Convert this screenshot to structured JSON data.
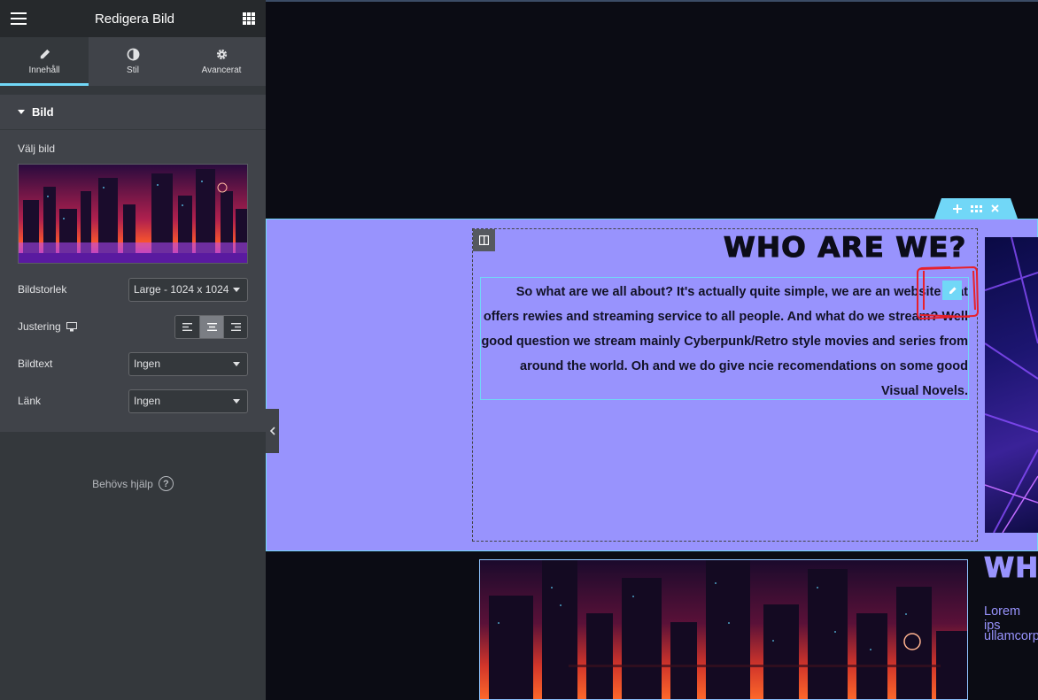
{
  "sidebar": {
    "title": "Redigera Bild",
    "tabs": [
      {
        "label": "Innehåll",
        "icon": "pencil-icon"
      },
      {
        "label": "Stil",
        "icon": "half-circle-icon"
      },
      {
        "label": "Avancerat",
        "icon": "gear-icon"
      }
    ],
    "section_title": "Bild",
    "choose_image_label": "Välj bild",
    "image_size": {
      "label": "Bildstorlek",
      "value": "Large - 1024 x 1024"
    },
    "alignment": {
      "label": "Justering",
      "selected": "center"
    },
    "caption": {
      "label": "Bildtext",
      "value": "Ingen"
    },
    "link": {
      "label": "Länk",
      "value": "Ingen"
    },
    "help_label": "Behövs hjälp",
    "help_icon_glyph": "?"
  },
  "canvas": {
    "section_handle_icons": [
      "plus-icon",
      "drag-handle-icon",
      "close-icon"
    ],
    "heading": "WHO ARE WE?",
    "body_text": "So what are we all about? It's actually quite simple, we are an website that offers rewies and streaming service to all people. And what do we stream? Well good question we stream mainly Cyberpunk/Retro style movies and series from around the world. Oh and we do give ncie recomendations on some good Visual Novels.",
    "second_heading_fragment": "WHY",
    "lorem_line_1": "Lorem ips",
    "lorem_line_2": "ullamcorp",
    "colors": {
      "section_bg": "#9893fd",
      "accent": "#71d7f7",
      "annotation": "#e8202a",
      "sidebar_bg": "#404349"
    }
  }
}
